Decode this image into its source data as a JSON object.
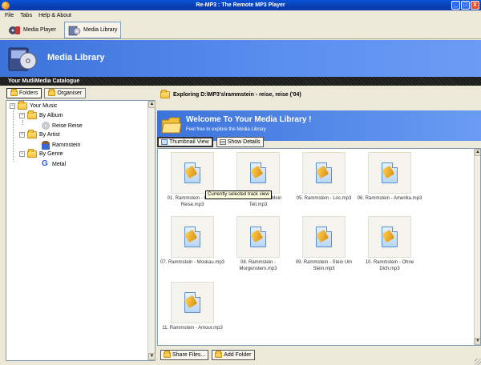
{
  "window": {
    "title": "Re-MP3 : The Remote MP3 Player",
    "buttons": [
      "_",
      "□",
      "X"
    ]
  },
  "menu": [
    "File",
    "Tabs",
    "Help & About"
  ],
  "toolbar": {
    "player_label": "Media Player",
    "library_label": "Media Library"
  },
  "banner": {
    "title": "Media Library"
  },
  "catalog": {
    "title": "Your MutliMedia Catalogue"
  },
  "left": {
    "tabs": [
      "Folders",
      "Organiser"
    ],
    "tree": {
      "root": "Your Music",
      "by_album": "By Album",
      "album": "Reise Reise",
      "by_artist": "By Artist",
      "artist": "Rammstein",
      "by_genre": "By Genre",
      "genre": "Metal"
    }
  },
  "right": {
    "exploring": "Exploring D:\\MP3's\\rammstein - reise, reise ('04)",
    "welcome_title": "Welcome To Your Media Library !",
    "welcome_sub": "Feel free to explore the Media Library",
    "thumbnail_view": "Thumbnail View",
    "show_details": "Show Details",
    "tooltip": "Currently selected track view",
    "files": [
      "01. Rammstein - Reise, Reise.mp3",
      "02. Rammstein - Mein Teil.mp3",
      "05. Rammstein - Los.mp3",
      "06. Rammstein - Amerika.mp3",
      "07. Rammstein - Moskau.mp3",
      "08. Rammstein - Morgenstern.mp3",
      "09. Rammstein - Stein Um Stein.mp3",
      "10. Rammstein - Ohne Dich.mp3",
      "11. Rammstein - Amour.mp3"
    ],
    "share_files": "Share Files...",
    "add_folder": "Add Folder"
  }
}
